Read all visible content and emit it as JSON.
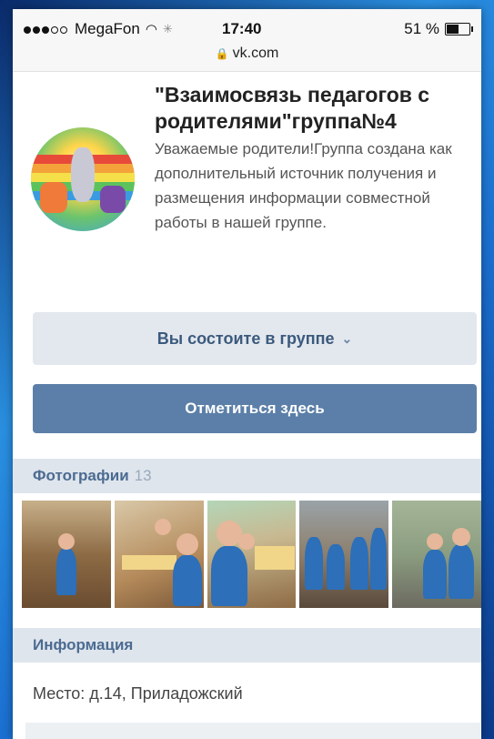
{
  "status": {
    "carrier": "MegaFon",
    "time": "17:40",
    "battery": "51 %",
    "url": "vk.com"
  },
  "group": {
    "title": "\"Взаимосвязь педагогов с родителями\"группа№4",
    "description": "Уважаемые родители!Группа создана как дополнительный источник получения и размещения информации совместной работы в нашей группе."
  },
  "buttons": {
    "member": "Вы состоите в группе",
    "checkin": "Отметиться здесь"
  },
  "photos": {
    "label": "Фотографии",
    "count": "13"
  },
  "info": {
    "label": "Информация",
    "place": "Место: д.14, Приладожский"
  },
  "colors": {
    "accent": "#5b7fa8",
    "section_bg": "#dfe5ec",
    "member_btn_bg": "#e3e8ee"
  },
  "icons": {
    "signal": "signal-dots-icon",
    "wifi": "wifi-icon",
    "battery": "battery-icon",
    "lock": "lock-icon",
    "chevron": "chevron-down-icon"
  }
}
